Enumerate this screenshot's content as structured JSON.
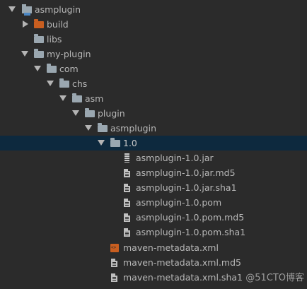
{
  "tree": {
    "root": "asmplugin",
    "build": "build",
    "libs": "libs",
    "my_plugin": "my-plugin",
    "com": "com",
    "chs": "chs",
    "asm": "asm",
    "plugin": "plugin",
    "asmplugin_pkg": "asmplugin",
    "version": "1.0",
    "files": [
      "asmplugin-1.0.jar",
      "asmplugin-1.0.jar.md5",
      "asmplugin-1.0.jar.sha1",
      "asmplugin-1.0.pom",
      "asmplugin-1.0.pom.md5",
      "asmplugin-1.0.pom.sha1"
    ],
    "metadata": [
      "maven-metadata.xml",
      "maven-metadata.xml.md5",
      "maven-metadata.xml.sha1"
    ]
  },
  "watermark": "@51CTO博客",
  "colors": {
    "background": "#2b2b2b",
    "selected_row": "#0d293e",
    "text": "#b7b7b7",
    "folder": "#9aa7b0",
    "excluded_folder": "#c85e20"
  }
}
